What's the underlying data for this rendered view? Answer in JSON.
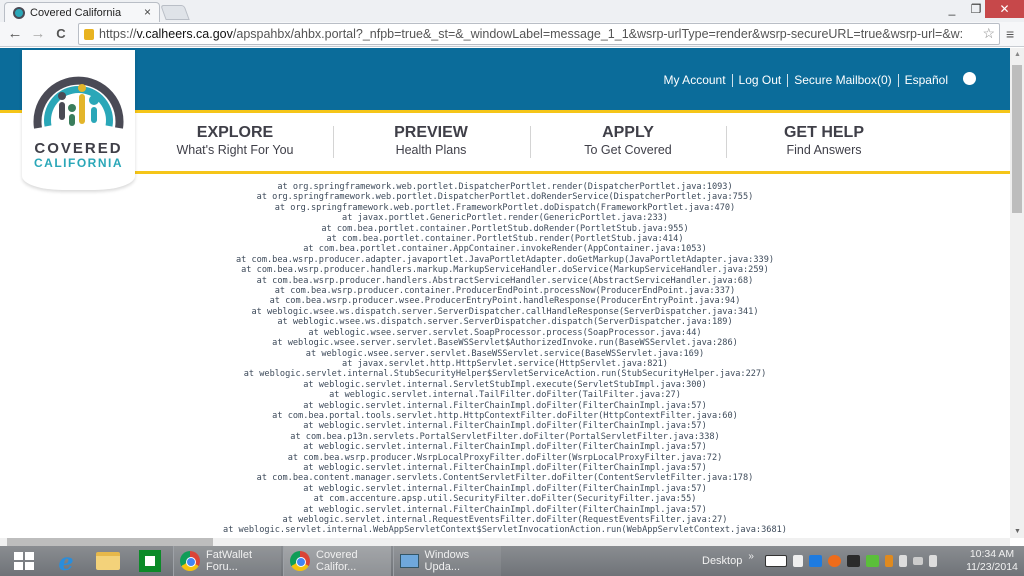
{
  "browser": {
    "tab_title": "Covered California",
    "tab_close": "×",
    "window_controls": {
      "minimize": "_",
      "maximize": "❐",
      "close": "✕"
    },
    "nav": {
      "back": "←",
      "forward": "→",
      "reload": "C"
    },
    "url": {
      "scheme": "https://",
      "host": "v.calheers.ca.gov",
      "path": "/apspahbx/ahbx.portal?_nfpb=true&_st=&_windowLabel=message_1_1&wsrp-urlType=render&wsrp-secureURL=true&wsrp-url=&w:"
    },
    "bookmark_icon": "☆",
    "menu_icon": "≡"
  },
  "site": {
    "logo": {
      "line1": "COVERED",
      "line2": "CALIFORNIA",
      "colors": {
        "arc": "#4a4a55",
        "teal": "#2aa7b8",
        "yellow": "#e3b52a",
        "green": "#3a7d5c"
      }
    },
    "top_links": [
      "My Account",
      "Log Out",
      "Secure Mailbox(0)",
      "Español"
    ],
    "globe_icon": "globe-icon",
    "main_nav": [
      {
        "title": "EXPLORE",
        "subtitle": "What's Right For You"
      },
      {
        "title": "PREVIEW",
        "subtitle": "Health Plans"
      },
      {
        "title": "APPLY",
        "subtitle": "To Get Covered"
      },
      {
        "title": "GET HELP",
        "subtitle": "Find Answers"
      }
    ],
    "colors": {
      "band": "#0b6c9a",
      "accent": "#f5c518",
      "text": "#3f3f48"
    }
  },
  "stack_trace": [
    "at org.springframework.web.portlet.DispatcherPortlet.render(DispatcherPortlet.java:1093)",
    "at org.springframework.web.portlet.DispatcherPortlet.doRenderService(DispatcherPortlet.java:755)",
    "at org.springframework.web.portlet.FrameworkPortlet.doDispatch(FrameworkPortlet.java:470)",
    "at javax.portlet.GenericPortlet.render(GenericPortlet.java:233)",
    "at com.bea.portlet.container.PortletStub.doRender(PortletStub.java:955)",
    "at com.bea.portlet.container.PortletStub.render(PortletStub.java:414)",
    "at com.bea.portlet.container.AppContainer.invokeRender(AppContainer.java:1053)",
    "at com.bea.wsrp.producer.adapter.javaportlet.JavaPortletAdapter.doGetMarkup(JavaPortletAdapter.java:339)",
    "at com.bea.wsrp.producer.handlers.markup.MarkupServiceHandler.doService(MarkupServiceHandler.java:259)",
    "at com.bea.wsrp.producer.handlers.AbstractServiceHandler.service(AbstractServiceHandler.java:68)",
    "at com.bea.wsrp.producer.container.ProducerEndPoint.processNow(ProducerEndPoint.java:337)",
    "at com.bea.wsrp.producer.wsee.ProducerEntryPoint.handleResponse(ProducerEntryPoint.java:94)",
    "at weblogic.wsee.ws.dispatch.server.ServerDispatcher.callHandleResponse(ServerDispatcher.java:341)",
    "at weblogic.wsee.ws.dispatch.server.ServerDispatcher.dispatch(ServerDispatcher.java:189)",
    "at weblogic.wsee.server.servlet.SoapProcessor.process(SoapProcessor.java:44)",
    "at weblogic.wsee.server.servlet.BaseWSServlet$AuthorizedInvoke.run(BaseWSServlet.java:286)",
    "at weblogic.wsee.server.servlet.BaseWSServlet.service(BaseWSServlet.java:169)",
    "at javax.servlet.http.HttpServlet.service(HttpServlet.java:821)",
    "at weblogic.servlet.internal.StubSecurityHelper$ServletServiceAction.run(StubSecurityHelper.java:227)",
    "at weblogic.servlet.internal.ServletStubImpl.execute(ServletStubImpl.java:300)",
    "at weblogic.servlet.internal.TailFilter.doFilter(TailFilter.java:27)",
    "at weblogic.servlet.internal.FilterChainImpl.doFilter(FilterChainImpl.java:57)",
    "at com.bea.portal.tools.servlet.http.HttpContextFilter.doFilter(HttpContextFilter.java:60)",
    "at weblogic.servlet.internal.FilterChainImpl.doFilter(FilterChainImpl.java:57)",
    "at com.bea.p13n.servlets.PortalServletFilter.doFilter(PortalServletFilter.java:338)",
    "at weblogic.servlet.internal.FilterChainImpl.doFilter(FilterChainImpl.java:57)",
    "at com.bea.wsrp.producer.WsrpLocalProxyFilter.doFilter(WsrpLocalProxyFilter.java:72)",
    "at weblogic.servlet.internal.FilterChainImpl.doFilter(FilterChainImpl.java:57)",
    "at com.bea.content.manager.servlets.ContentServletFilter.doFilter(ContentServletFilter.java:178)",
    "at weblogic.servlet.internal.FilterChainImpl.doFilter(FilterChainImpl.java:57)",
    "at com.accenture.apsp.util.SecurityFilter.doFilter(SecurityFilter.java:55)",
    "at weblogic.servlet.internal.FilterChainImpl.doFilter(FilterChainImpl.java:57)",
    "at weblogic.servlet.internal.RequestEventsFilter.doFilter(RequestEventsFilter.java:27)",
    "at weblogic.servlet.internal.WebAppServletContext$ServletInvocationAction.run(WebAppServletContext.java:3681)"
  ],
  "taskbar": {
    "pinned": [
      "windows-start",
      "internet-explorer",
      "file-explorer",
      "windows-store"
    ],
    "tasks": [
      {
        "label": "FatWallet Foru...",
        "icon": "chrome-icon",
        "active": false
      },
      {
        "label": "Covered Califor...",
        "icon": "chrome-icon",
        "active": true
      },
      {
        "label": "Windows Upda...",
        "icon": "windows-update-icon",
        "active": false
      }
    ],
    "desktop_label": "Desktop",
    "overflow": "»",
    "clock": {
      "time": "10:34 AM",
      "date": "11/23/2014"
    }
  }
}
